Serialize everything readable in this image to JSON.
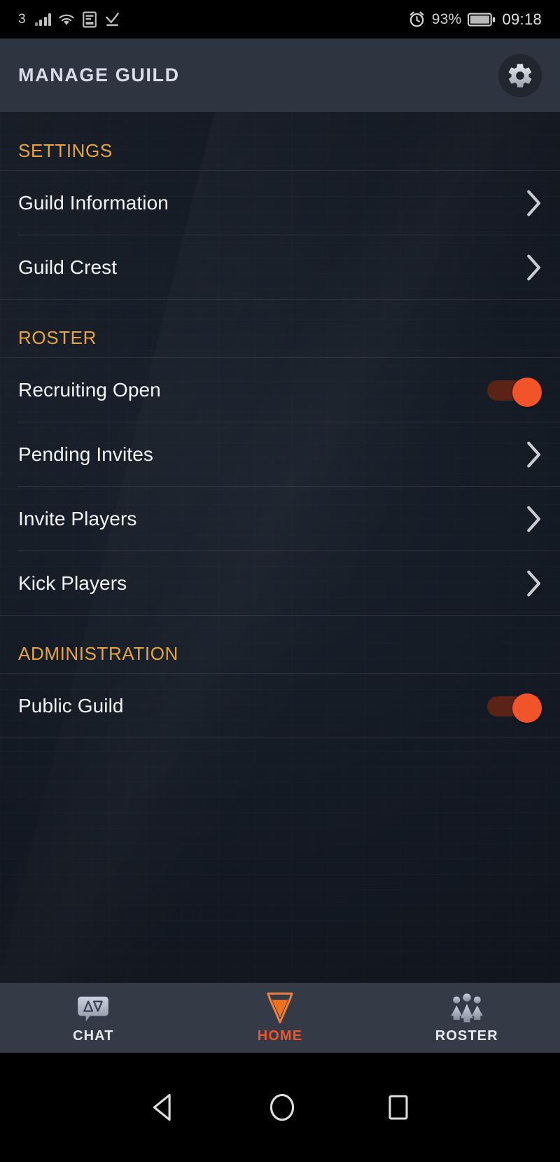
{
  "status_bar": {
    "carrier": "3",
    "signal_icon": "signal-bars-icon",
    "wifi_icon": "wifi-icon",
    "sim_icon": "sim-card-icon",
    "download_icon": "download-complete-icon",
    "alarm_icon": "alarm-clock-icon",
    "battery_percent": "93%",
    "battery_icon": "battery-icon",
    "clock": "09:18"
  },
  "header": {
    "title": "MANAGE GUILD",
    "settings_icon": "gear-icon"
  },
  "sections": [
    {
      "heading": "SETTINGS",
      "rows": [
        {
          "label": "Guild Information",
          "control": "chevron",
          "name": "guild-information"
        },
        {
          "label": "Guild Crest",
          "control": "chevron",
          "name": "guild-crest"
        }
      ]
    },
    {
      "heading": "ROSTER",
      "rows": [
        {
          "label": "Recruiting Open",
          "control": "toggle",
          "toggle_state": "on",
          "name": "recruiting-open"
        },
        {
          "label": "Pending Invites",
          "control": "chevron",
          "name": "pending-invites"
        },
        {
          "label": "Invite Players",
          "control": "chevron",
          "name": "invite-players"
        },
        {
          "label": "Kick Players",
          "control": "chevron",
          "name": "kick-players"
        }
      ]
    },
    {
      "heading": "ADMINISTRATION",
      "rows": [
        {
          "label": "Public Guild",
          "control": "toggle",
          "toggle_state": "on",
          "name": "public-guild"
        }
      ]
    }
  ],
  "bottom_nav": [
    {
      "label": "CHAT",
      "icon": "chat-bubble-icon",
      "active": false
    },
    {
      "label": "HOME",
      "icon": "home-shield-icon",
      "active": true
    },
    {
      "label": "ROSTER",
      "icon": "people-group-icon",
      "active": false
    }
  ],
  "android_nav": {
    "back_icon": "back-triangle-icon",
    "home_icon": "home-circle-icon",
    "recents_icon": "recents-square-icon"
  },
  "colors": {
    "accent_orange": "#f2542a",
    "section_gold": "#e8a53c",
    "header_bg": "#2e3440",
    "nav_bg": "#343b47",
    "content_bg": "#141a24"
  }
}
